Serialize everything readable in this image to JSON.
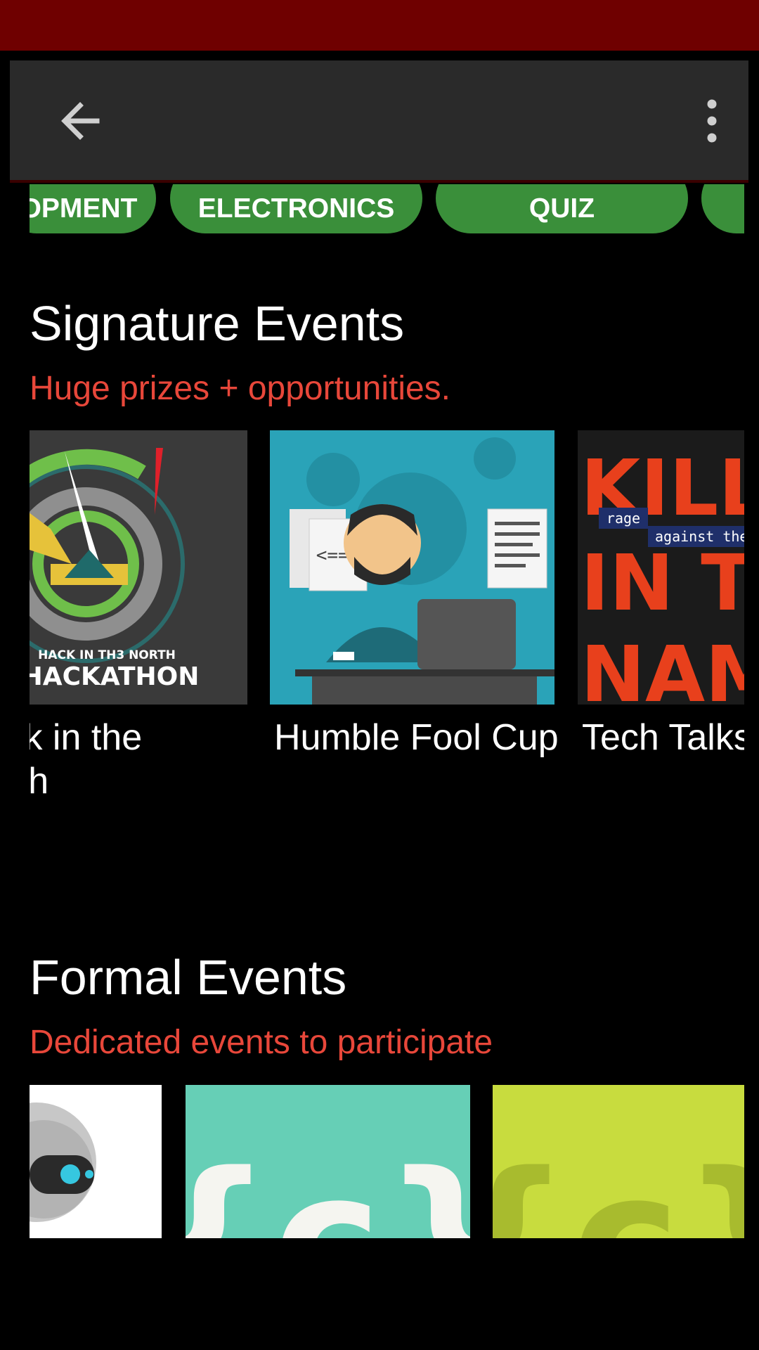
{
  "categories": [
    "OPMENT",
    "ELECTRONICS",
    "QUIZ",
    ""
  ],
  "signature": {
    "heading": "Signature Events",
    "subheading": "Huge prizes + opportunities.",
    "cards": [
      {
        "title": "Hack in the North",
        "image_text_top": "HACK IN TH3 NORTH",
        "image_text_main": "HACKATHON"
      },
      {
        "title": "Humble Fool Cup"
      },
      {
        "title": "Tech Talks",
        "poster_text": [
          "KILLING",
          "IN THE",
          "NAME"
        ],
        "poster_tag1": "rage",
        "poster_tag2": "against the"
      }
    ]
  },
  "formal": {
    "heading": "Formal Events",
    "subheading": "Dedicated events to participate",
    "tiles": [
      {
        "bg": "#ffffff"
      },
      {
        "bg": "#66cfb6",
        "glyph": "{c}"
      },
      {
        "bg": "#c8dc3e",
        "glyph": "{c}"
      }
    ]
  },
  "colors": {
    "status_bar": "#6f0000",
    "toolbar": "#2a2a2a",
    "chip": "#3a8f3a",
    "accent": "#e8473a"
  },
  "icons": [
    "arrow-back-icon",
    "more-vert-icon"
  ]
}
